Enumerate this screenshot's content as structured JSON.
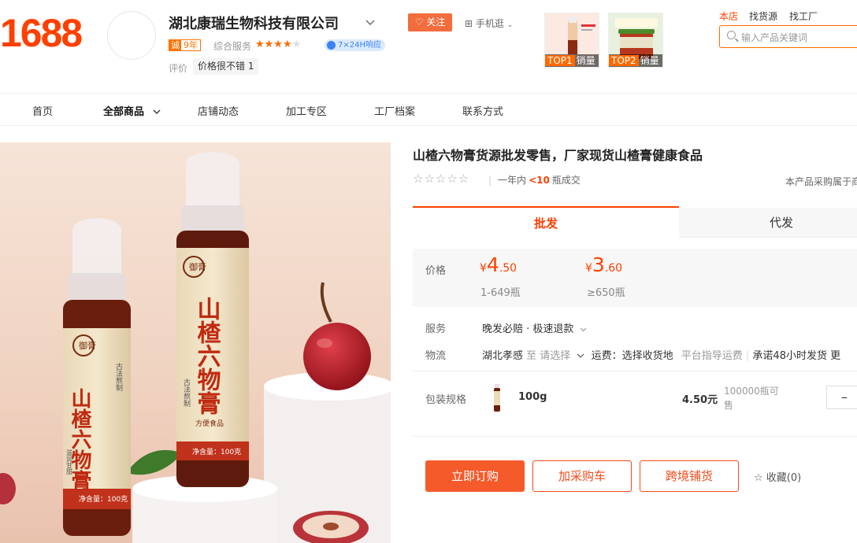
{
  "header": {
    "logo": "1688",
    "shop_name": "湖北康瑞生物科技有限公司",
    "year_badge_lead": "诚",
    "year_badge": "9年",
    "service_label": "综合服务",
    "service_rating": 4,
    "response_badge": "7×24H响应",
    "review_label": "评价",
    "review_tag": "价格很不错 1",
    "follow_button": "关注",
    "mobile_link": "手机逛",
    "top_products": [
      {
        "rank": "TOP1",
        "label": "销量"
      },
      {
        "rank": "TOP2",
        "label": "销量"
      }
    ],
    "search_scopes": [
      "本店",
      "找货源",
      "找工厂"
    ],
    "search_placeholder": "输入产品关键词"
  },
  "nav": {
    "items": [
      "首页",
      "全部商品",
      "店铺动态",
      "加工专区",
      "工厂档案",
      "联系方式"
    ]
  },
  "product": {
    "title": "山楂六物膏货源批发零售，厂家现货山楂膏健康食品",
    "sold_prefix": "一年内",
    "sold_count": "<10",
    "sold_suffix": "瓶成交",
    "purchase_note": "本产品采购属于商",
    "tabs": [
      "批发",
      "代发"
    ],
    "price_label": "价格",
    "prices": [
      {
        "currency": "¥",
        "integer": "4",
        "decimal": ".50",
        "range": "1-649瓶"
      },
      {
        "currency": "¥",
        "integer": "3",
        "decimal": ".60",
        "range": "≥650瓶"
      }
    ],
    "service_label": "服务",
    "service_value": "晚发必赔 · 极速退款",
    "logistics_label": "物流",
    "logistics_origin": "湖北孝感",
    "logistics_to": "至 请选择",
    "logistics_fee": "运费：选择收货地",
    "logistics_guide": "平台指导运费",
    "logistics_promise": "承诺48小时发货",
    "logistics_more": "更",
    "sku_label": "包装规格",
    "sku_name": "100g",
    "sku_price": "4.50元",
    "sku_stock": "100000瓶可售",
    "qty_minus": "–",
    "buttons": {
      "order": "立即订购",
      "cart": "加采购车",
      "cross": "跨境铺货",
      "favorite": "收藏(0)"
    }
  },
  "image_text": {
    "bottle_brand": "御膏",
    "bottle_name": "山楂六物膏",
    "bottle_side1": "古法熬制",
    "bottle_side2": "滋润甘甜",
    "bottle_type": "方便食品",
    "bottle_net": "净含量：100克"
  },
  "colors": {
    "brand_orange": "#ff4000",
    "button_orange": "#f55a2a"
  }
}
